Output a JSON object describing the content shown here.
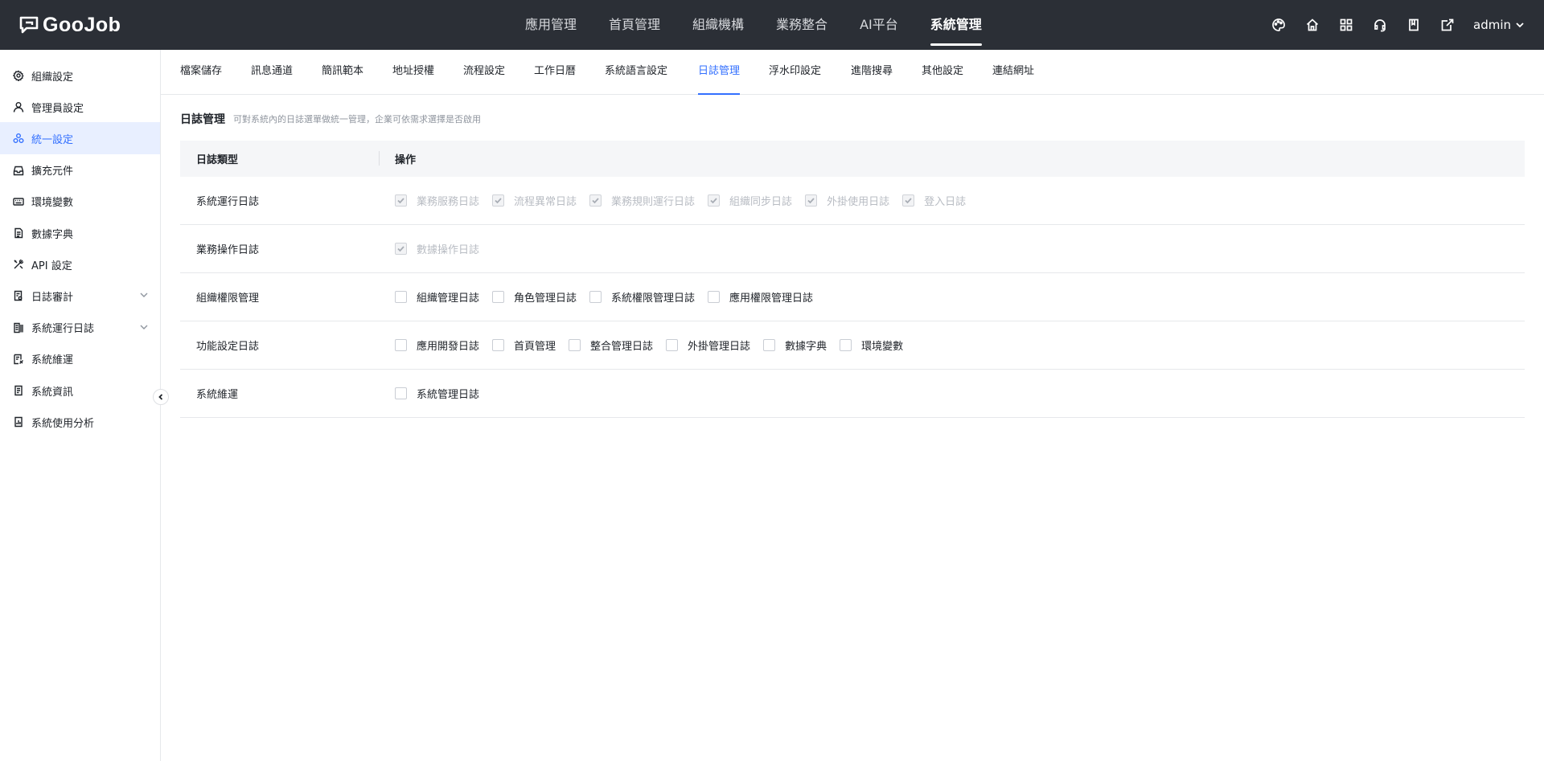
{
  "app": {
    "logo": "GooJob"
  },
  "topnav": [
    {
      "label": "應用管理",
      "active": false
    },
    {
      "label": "首頁管理",
      "active": false
    },
    {
      "label": "組織機構",
      "active": false
    },
    {
      "label": "業務整合",
      "active": false
    },
    {
      "label": "AI平台",
      "active": false
    },
    {
      "label": "系統管理",
      "active": true
    }
  ],
  "topright": {
    "icons": [
      "palette-icon",
      "home-icon",
      "grid-icon",
      "headset-icon",
      "book-icon",
      "export-icon"
    ],
    "user": "admin"
  },
  "sidebar": {
    "items": [
      {
        "label": "組織設定",
        "icon": "gear-icon",
        "active": false
      },
      {
        "label": "管理員設定",
        "icon": "user-icon",
        "active": false
      },
      {
        "label": "統一設定",
        "icon": "cluster-icon",
        "active": true
      },
      {
        "label": "擴充元件",
        "icon": "inbox-icon",
        "active": false
      },
      {
        "label": "環境變數",
        "icon": "keyboard-icon",
        "active": false
      },
      {
        "label": "數據字典",
        "icon": "document-icon",
        "active": false
      },
      {
        "label": "API 設定",
        "icon": "tools-icon",
        "active": false
      },
      {
        "label": "日誌審計",
        "icon": "audit-icon",
        "active": false,
        "expandable": true
      },
      {
        "label": "系統運行日誌",
        "icon": "log-icon",
        "active": false,
        "expandable": true
      },
      {
        "label": "系統維運",
        "icon": "maintenance-icon",
        "active": false
      },
      {
        "label": "系統資訊",
        "icon": "info-doc-icon",
        "active": false
      },
      {
        "label": "系統使用分析",
        "icon": "analysis-icon",
        "active": false
      }
    ]
  },
  "subtabs": [
    {
      "label": "檔案儲存",
      "active": false
    },
    {
      "label": "訊息通道",
      "active": false
    },
    {
      "label": "簡訊範本",
      "active": false
    },
    {
      "label": "地址授權",
      "active": false
    },
    {
      "label": "流程設定",
      "active": false
    },
    {
      "label": "工作日曆",
      "active": false
    },
    {
      "label": "系統語言設定",
      "active": false
    },
    {
      "label": "日誌管理",
      "active": true
    },
    {
      "label": "浮水印設定",
      "active": false
    },
    {
      "label": "進階搜尋",
      "active": false
    },
    {
      "label": "其他設定",
      "active": false
    },
    {
      "label": "連結網址",
      "active": false
    }
  ],
  "section": {
    "title": "日誌管理",
    "desc": "可對系統內的日誌選單做統一管理，企業可依需求選擇是否啟用"
  },
  "table": {
    "headers": [
      "日誌類型",
      "操作"
    ],
    "rows": [
      {
        "type": "系統運行日誌",
        "options": [
          {
            "label": "業務服務日誌",
            "checked": true,
            "disabled": true
          },
          {
            "label": "流程異常日誌",
            "checked": true,
            "disabled": true
          },
          {
            "label": "業務規則運行日誌",
            "checked": true,
            "disabled": true
          },
          {
            "label": "組織同步日誌",
            "checked": true,
            "disabled": true
          },
          {
            "label": "外掛使用日誌",
            "checked": true,
            "disabled": true
          },
          {
            "label": "登入日誌",
            "checked": true,
            "disabled": true
          }
        ]
      },
      {
        "type": "業務操作日誌",
        "options": [
          {
            "label": "數據操作日誌",
            "checked": true,
            "disabled": true
          }
        ]
      },
      {
        "type": "組織權限管理",
        "options": [
          {
            "label": "組織管理日誌",
            "checked": false,
            "disabled": false
          },
          {
            "label": "角色管理日誌",
            "checked": false,
            "disabled": false
          },
          {
            "label": "系統權限管理日誌",
            "checked": false,
            "disabled": false
          },
          {
            "label": "應用權限管理日誌",
            "checked": false,
            "disabled": false
          }
        ]
      },
      {
        "type": "功能設定日誌",
        "options": [
          {
            "label": "應用開發日誌",
            "checked": false,
            "disabled": false
          },
          {
            "label": "首頁管理",
            "checked": false,
            "disabled": false
          },
          {
            "label": "整合管理日誌",
            "checked": false,
            "disabled": false
          },
          {
            "label": "外掛管理日誌",
            "checked": false,
            "disabled": false
          },
          {
            "label": "數據字典",
            "checked": false,
            "disabled": false
          },
          {
            "label": "環境變數",
            "checked": false,
            "disabled": false
          }
        ]
      },
      {
        "type": "系統維運",
        "options": [
          {
            "label": "系統管理日誌",
            "checked": false,
            "disabled": false
          }
        ]
      }
    ]
  },
  "colors": {
    "accent": "#3370ff",
    "topbar": "#2b2f36",
    "sidebarActive": "#e8efff"
  }
}
